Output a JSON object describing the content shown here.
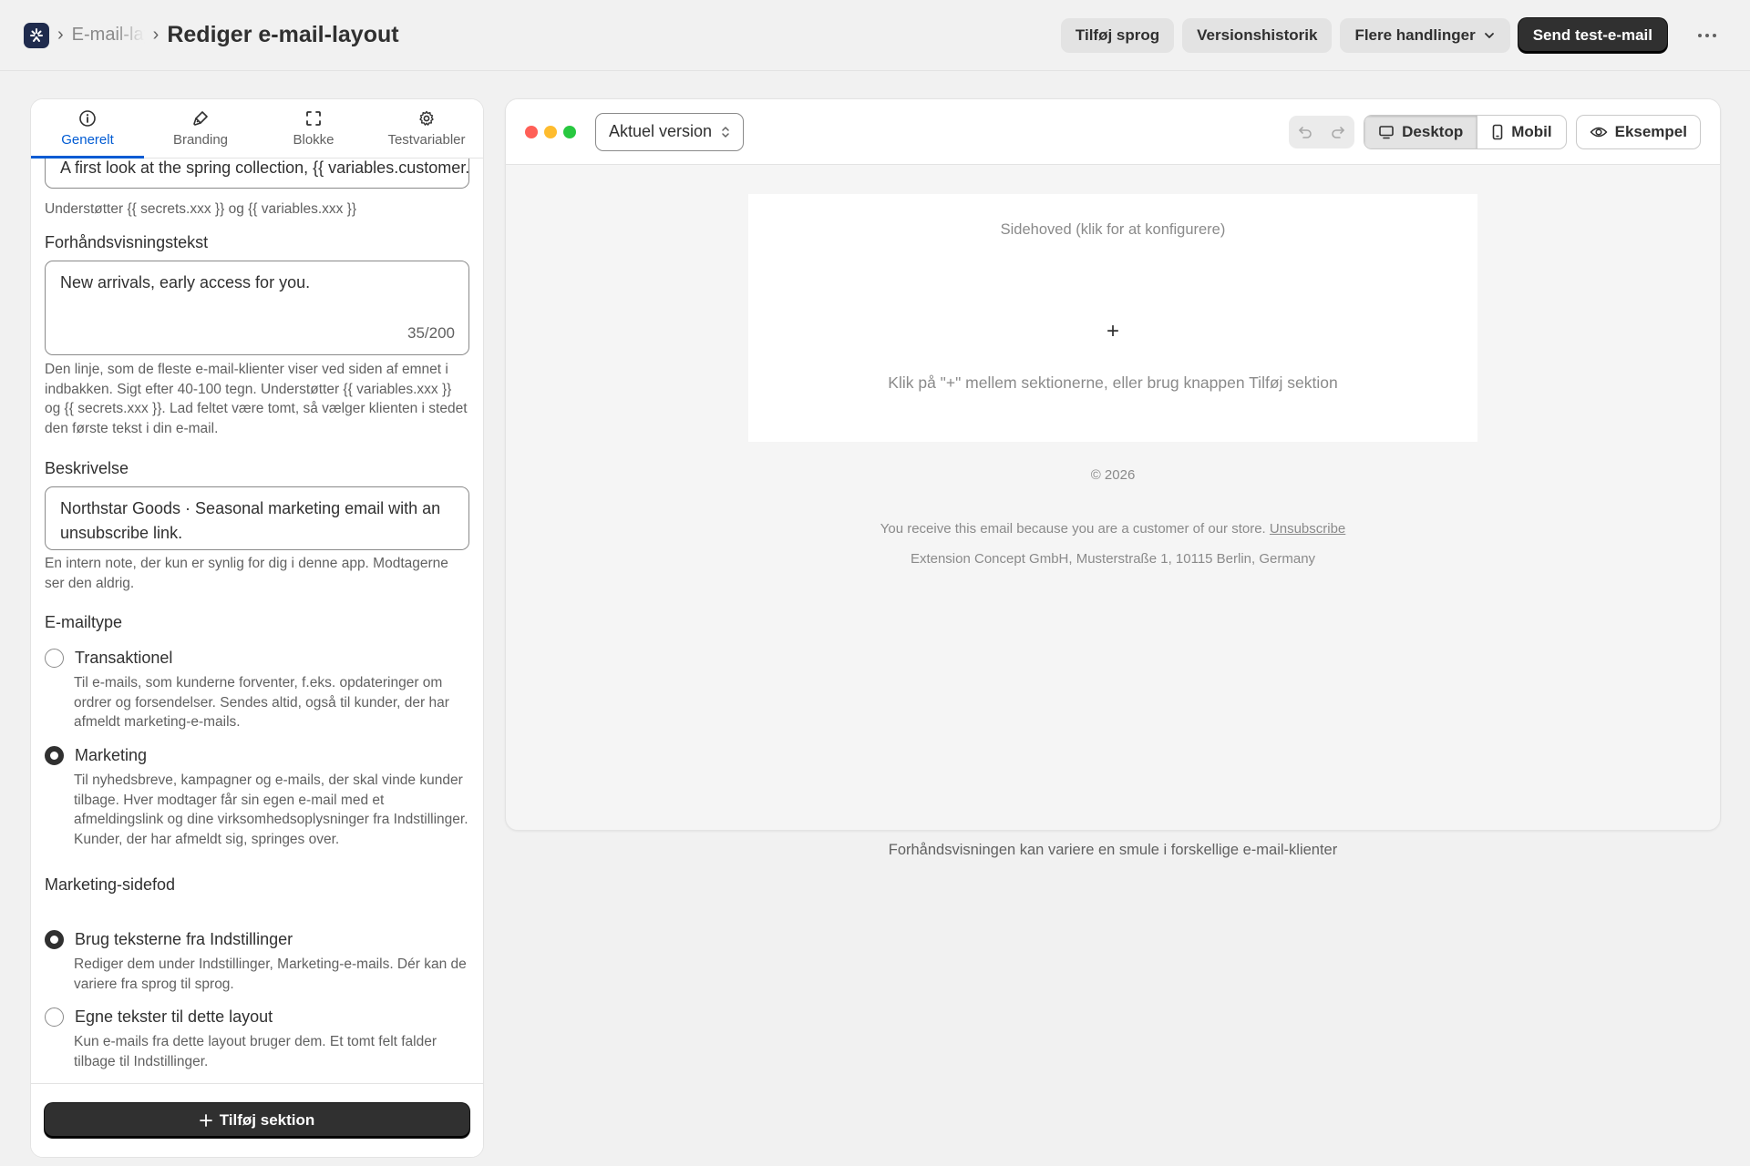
{
  "header": {
    "breadcrumb_parent": "E-mail-layouts",
    "title": "Rediger e-mail-layout",
    "actions": {
      "add_language": "Tilføj sprog",
      "version_history": "Versionshistorik",
      "more_actions": "Flere handlinger",
      "send_test": "Send test-e-mail"
    }
  },
  "tabs": [
    {
      "label": "Generelt",
      "icon": "info-icon",
      "active": true
    },
    {
      "label": "Branding",
      "icon": "paint-brush-icon",
      "active": false
    },
    {
      "label": "Blokke",
      "icon": "blocks-icon",
      "active": false
    },
    {
      "label": "Testvariabler",
      "icon": "gear-icon",
      "active": false
    }
  ],
  "general": {
    "subject_value": "A first look at the spring collection, {{ variables.customer.first_name }}",
    "subject_help": "Understøtter {{ secrets.xxx }} og {{ variables.xxx }}",
    "preview_text": {
      "label": "Forhåndsvisningstekst",
      "value": "New arrivals, early access for you.",
      "counter": "35/200",
      "help": "Den linje, som de fleste e-mail-klienter viser ved siden af emnet i indbakken. Sigt efter 40-100 tegn. Understøtter {{ variables.xxx }} og {{ secrets.xxx }}. Lad feltet være tomt, så vælger klienten i stedet den første tekst i din e-mail."
    },
    "description": {
      "label": "Beskrivelse",
      "value": "Northstar Goods · Seasonal marketing email with an unsubscribe link.",
      "help": "En intern note, der kun er synlig for dig i denne app. Modtagerne ser den aldrig."
    },
    "email_type": {
      "label": "E-mailtype",
      "options": [
        {
          "label": "Transaktionel",
          "help": "Til e-mails, som kunderne forventer, f.eks. opdateringer om ordrer og forsendelser. Sendes altid, også til kunder, der har afmeldt marketing-e-mails.",
          "checked": false
        },
        {
          "label": "Marketing",
          "help": "Til nyhedsbreve, kampagner og e-mails, der skal vinde kunder tilbage. Hver modtager får sin egen e-mail med et afmeldingslink og dine virksomhedsoplysninger fra Indstillinger. Kunder, der har afmeldt sig, springes over.",
          "checked": true
        }
      ]
    },
    "marketing_footer": {
      "label": "Marketing-sidefod",
      "options": [
        {
          "label": "Brug teksterne fra Indstillinger",
          "help": "Rediger dem under Indstillinger, Marketing-e-mails. Dér kan de variere fra sprog til sprog.",
          "checked": true
        },
        {
          "label": "Egne tekster til dette layout",
          "help": "Kun e-mails fra dette layout bruger dem. Et tomt felt falder tilbage til Indstillinger.",
          "checked": false
        }
      ]
    },
    "add_section": "Tilføj sektion"
  },
  "preview": {
    "version": "Aktuel version",
    "view_desktop": "Desktop",
    "view_mobile": "Mobil",
    "example": "Eksempel",
    "header_hint": "Sidehoved (klik for at konfigurere)",
    "plus": "+",
    "empty_hint": "Klik på \"+\" mellem sektionerne, eller brug knappen Tilføj sektion",
    "copyright": "© 2026",
    "footer_text": "You receive this email because you are a customer of our store.",
    "unsubscribe": "Unsubscribe",
    "address": "Extension Concept GmbH, Musterstraße 1, 10115 Berlin, Germany",
    "note": "Forhåndsvisningen kan variere en smule i forskellige e-mail-klienter"
  },
  "colors": {
    "accent": "#005bd3",
    "primary_button": "#303030",
    "background": "#f1f1f1",
    "traffic_red": "#ff5f57",
    "traffic_yellow": "#febc2e",
    "traffic_green": "#28c840"
  }
}
